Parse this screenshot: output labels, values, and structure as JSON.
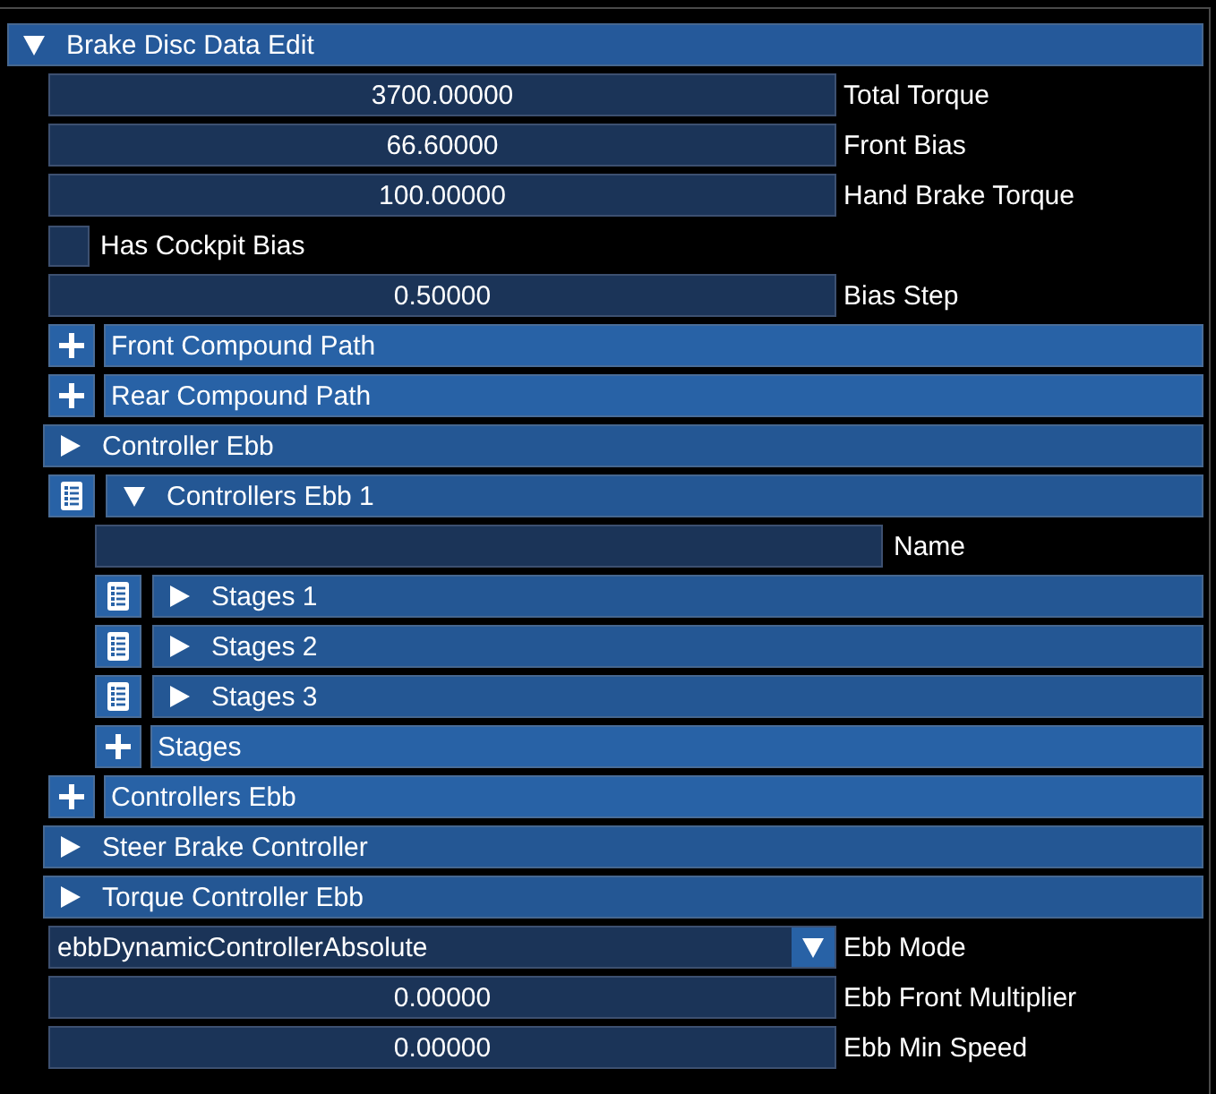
{
  "panel": {
    "title": "Brake Disc Data Edit",
    "expanded": true,
    "rows": [
      {
        "kind": "number",
        "value": "3700.00000",
        "label": "Total Torque"
      },
      {
        "kind": "number",
        "value": "66.60000",
        "label": "Front Bias"
      },
      {
        "kind": "number",
        "value": "100.00000",
        "label": "Hand Brake Torque"
      },
      {
        "kind": "checkbox",
        "label": "Has Cockpit Bias",
        "checked": false
      },
      {
        "kind": "number",
        "value": "0.50000",
        "label": "Bias Step"
      },
      {
        "kind": "add",
        "title": "Front Compound Path"
      },
      {
        "kind": "add",
        "title": "Rear Compound Path"
      },
      {
        "kind": "group",
        "title": "Controller Ebb",
        "expanded": false
      },
      {
        "kind": "item",
        "title": "Controllers Ebb 1",
        "expanded": true,
        "children": [
          {
            "kind": "text",
            "label": "Name"
          },
          {
            "kind": "item",
            "title": "Stages 1",
            "expanded": false
          },
          {
            "kind": "item",
            "title": "Stages 2",
            "expanded": false
          },
          {
            "kind": "item",
            "title": "Stages 3",
            "expanded": false
          },
          {
            "kind": "add",
            "title": "Stages"
          }
        ]
      },
      {
        "kind": "add",
        "title": "Controllers Ebb"
      },
      {
        "kind": "group",
        "title": "Steer Brake Controller",
        "expanded": false
      },
      {
        "kind": "group",
        "title": "Torque Controller Ebb",
        "expanded": false
      },
      {
        "kind": "select",
        "value": "ebbDynamicControllerAbsolute",
        "label": "Ebb Mode"
      },
      {
        "kind": "number",
        "value": "0.00000",
        "label": "Ebb Front Multiplier"
      },
      {
        "kind": "number",
        "value": "0.00000",
        "label": "Ebb Min Speed"
      }
    ]
  }
}
